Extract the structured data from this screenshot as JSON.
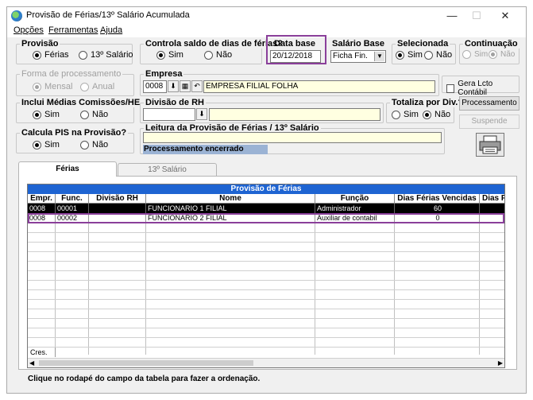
{
  "window": {
    "title": "Provisão de Férias/13º Salário Acumulada",
    "controls": {
      "minimize": "—",
      "maximize": "☐",
      "close": "✕"
    }
  },
  "menu": [
    "Opções",
    "Ferramentas",
    "Ajuda"
  ],
  "provisao": {
    "label": "Provisão",
    "options": [
      "Férias",
      "13º Salário"
    ],
    "selected": "Férias"
  },
  "controla_saldo": {
    "label": "Controla saldo de dias de férias?",
    "options": [
      "Sim",
      "Não"
    ],
    "selected": "Sim"
  },
  "data_base": {
    "label": "Data base",
    "value": "20/12/2018"
  },
  "salario_base": {
    "label": "Salário Base",
    "value": "Ficha Fin."
  },
  "selecionada": {
    "label": "Selecionada",
    "options": [
      "Sim",
      "Não"
    ],
    "selected": "Sim"
  },
  "continuacao": {
    "label": "Continuação",
    "options": [
      "Sim",
      "Não"
    ],
    "selected": "Não"
  },
  "forma_processamento": {
    "label": "Forma de processamento",
    "options": [
      "Mensal",
      "Anual"
    ],
    "selected": "Mensal"
  },
  "empresa": {
    "label": "Empresa",
    "code": "0008",
    "name": "EMPRESA FILIAL FOLHA"
  },
  "gera_lcto": {
    "label": "Gera Lcto Contábil",
    "checked": false
  },
  "inclui_medias": {
    "label": "Inclui Médias Comissões/HE",
    "options": [
      "Sim",
      "Não"
    ],
    "selected": "Sim"
  },
  "divisao_rh": {
    "label": "Divisão de RH",
    "code": "",
    "name": ""
  },
  "totaliza_div": {
    "label": "Totaliza por Div.?",
    "options": [
      "Sim",
      "Não"
    ],
    "selected": "Não"
  },
  "buttons": {
    "processamento": "Processamento",
    "suspende": "Suspende"
  },
  "calcula_pis": {
    "label": "Calcula PIS na Provisão?",
    "options": [
      "Sim",
      "Não"
    ],
    "selected": "Sim"
  },
  "leitura": {
    "label": "Leitura da Provisão de Férias / 13º Salário",
    "current": "",
    "status": "Processamento encerrado",
    "progress": 1.0
  },
  "tabs": [
    "Férias",
    "13º Salário"
  ],
  "active_tab": "Férias",
  "grid": {
    "title": "Provisão de Férias",
    "columns": [
      "Empr.",
      "Func.",
      "Divisão RH",
      "Nome",
      "Função",
      "Dias Férias Vencidas",
      "Dias P"
    ],
    "rows": [
      [
        "0008",
        "00001",
        "",
        "FUNCIONARIO 1 FILIAL",
        "Administrador",
        "60",
        ""
      ],
      [
        "0008",
        "00002",
        "",
        "FUNCIONARIO 2 FILIAL",
        "Auxiliar de contabil",
        "0",
        ""
      ]
    ],
    "footer_cell": "Cres."
  },
  "status_text": "Clique no rodapé do campo da tabela  para fazer a ordenação.",
  "colors": {
    "grid_header": "#1e64d2",
    "highlight": "#8a3f9a",
    "progress": "#9bb3d4",
    "input_yellow": "#ffffe1"
  }
}
